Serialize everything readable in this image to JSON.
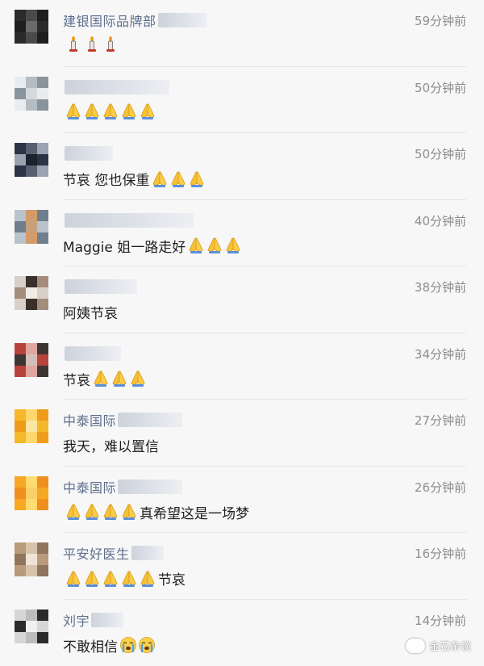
{
  "comments": [
    {
      "name": "建银国际品牌部",
      "blur_w": 60,
      "time": "59分钟前",
      "pre_text": "",
      "emoji": "candle",
      "count": 3,
      "post_text": "",
      "avatar": [
        "#2b2b2b",
        "#4a4a4a",
        "#1e1e1e",
        "#6a6a6a"
      ]
    },
    {
      "name": "",
      "blur_w": 130,
      "time": "50分钟前",
      "pre_text": "",
      "emoji": "pray",
      "count": 5,
      "post_text": "",
      "avatar": [
        "#e8ecef",
        "#b5bcc2",
        "#8a949c",
        "#d4d9dd"
      ]
    },
    {
      "name": "",
      "blur_w": 60,
      "time": "50分钟前",
      "pre_text": "节哀 您也保重",
      "emoji": "pray",
      "count": 3,
      "post_text": "",
      "avatar": [
        "#2a3446",
        "#58606f",
        "#9aa3b0",
        "#1c232f"
      ]
    },
    {
      "name": "",
      "blur_w": 160,
      "time": "40分钟前",
      "pre_text": "Maggie 姐一路走好",
      "emoji": "pray",
      "count": 3,
      "post_text": "",
      "avatar": [
        "#b9c3cc",
        "#d39b6a",
        "#6f7f8d",
        "#c7a07d"
      ]
    },
    {
      "name": "",
      "blur_w": 90,
      "time": "38分钟前",
      "pre_text": "阿姨节哀",
      "emoji": "pray",
      "count": 0,
      "post_text": "",
      "avatar": [
        "#d8d0c8",
        "#3a2f2a",
        "#a58d7c",
        "#f1ece6"
      ]
    },
    {
      "name": "",
      "blur_w": 70,
      "time": "34分钟前",
      "pre_text": "节哀",
      "emoji": "pray",
      "count": 3,
      "post_text": "",
      "avatar": [
        "#b7433b",
        "#e0a69f",
        "#3d3532",
        "#d5bdb7"
      ]
    },
    {
      "name": "中泰国际",
      "blur_w": 80,
      "time": "27分钟前",
      "pre_text": "我天，难以置信",
      "emoji": "pray",
      "count": 0,
      "post_text": "",
      "avatar": [
        "#f5b82a",
        "#ffd76a",
        "#ef9c1a",
        "#fbe6a2"
      ]
    },
    {
      "name": "中泰国际",
      "blur_w": 80,
      "time": "26分钟前",
      "pre_text": "",
      "emoji": "pray",
      "count": 4,
      "post_text": "真希望这是一场梦",
      "avatar": [
        "#f7a823",
        "#ffdb70",
        "#f08f1d",
        "#fcd067"
      ]
    },
    {
      "name": "平安好医生",
      "blur_w": 40,
      "time": "16分钟前",
      "pre_text": "",
      "emoji": "pray",
      "count": 5,
      "post_text": "节哀",
      "avatar": [
        "#b89b7a",
        "#d7c3ac",
        "#8f755c",
        "#efe3d5"
      ]
    },
    {
      "name": "刘宇",
      "blur_w": 40,
      "time": "14分钟前",
      "pre_text": "不敢相信",
      "emoji": "cry",
      "count": 2,
      "post_text": "",
      "avatar": [
        "#d6d6d6",
        "#bcbcbc",
        "#2b2b2b",
        "#f0f0f0"
      ]
    }
  ],
  "watermark": {
    "text": "金石杂谈"
  }
}
